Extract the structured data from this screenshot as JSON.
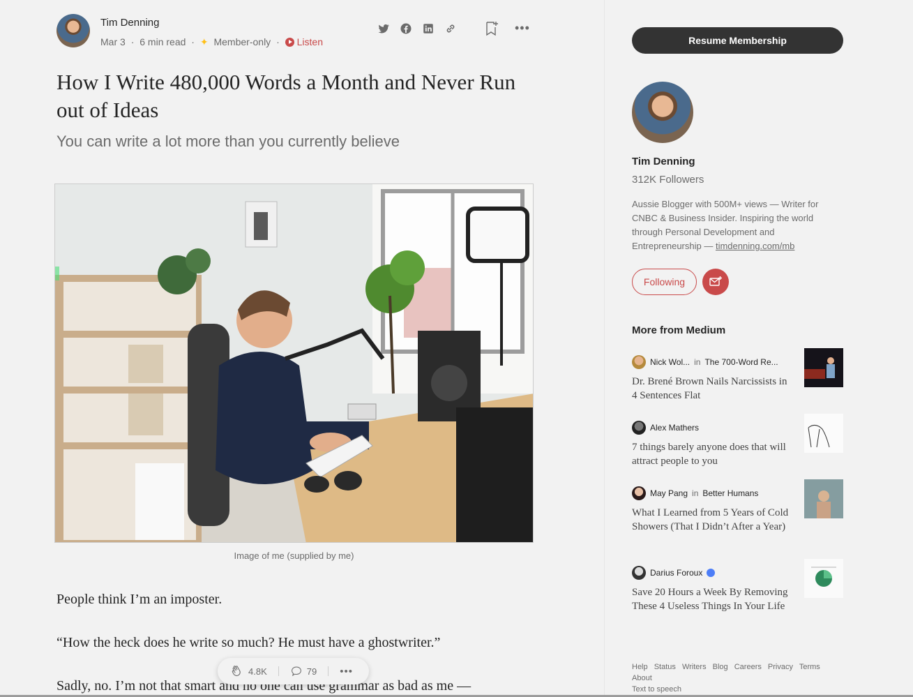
{
  "article": {
    "author_name": "Tim Denning",
    "date": "Mar 3",
    "read_time": "6 min read",
    "member_label": "Member-only",
    "listen_label": "Listen",
    "title": "How I Write 480,000 Words a Month and Never Run out of Ideas",
    "subtitle": "You can write a lot more than you currently believe",
    "caption": "Image of me (supplied by me)",
    "paragraphs": [
      "People think I’m an imposter.",
      "“How the heck does he write so much? He must have a ghostwriter.”",
      "Sadly, no. I’m not that smart and no one can use grammar as bad as me —"
    ],
    "share_icons": [
      "twitter-icon",
      "facebook-icon",
      "linkedin-icon",
      "link-icon"
    ]
  },
  "floatbar": {
    "claps": "4.8K",
    "responses": "79"
  },
  "sidebar": {
    "resume_label": "Resume Membership",
    "author_name": "Tim Denning",
    "followers": "312K Followers",
    "bio_text": "Aussie Blogger with 500M+ views — Writer for CNBC & Business Insider. Inspiring the world through Personal Development and Entrepreneurship — ",
    "bio_link": "timdenning.com/mb",
    "following_label": "Following",
    "more_from_label": "More from Medium",
    "stories": [
      {
        "author": "Nick Wol...",
        "in": "in",
        "publication": "The 700-Word Re...",
        "title": "Dr. Brené Brown Nails Narcissists in 4 Sentences Flat"
      },
      {
        "author": "Alex Mathers",
        "in": "",
        "publication": "",
        "title": "7 things barely anyone does that will attract people to you"
      },
      {
        "author": "May Pang",
        "in": "in",
        "publication": "Better Humans",
        "title": "What I Learned from 5 Years of Cold Showers (That I Didn’t After a Year)"
      },
      {
        "author": "Darius Foroux",
        "in": "",
        "publication": "",
        "title": "Save 20 Hours a Week By Removing These 4 Useless Things In Your Life"
      }
    ],
    "footer_links": [
      "Help",
      "Status",
      "Writers",
      "Blog",
      "Careers",
      "Privacy",
      "Terms",
      "About",
      "Text to speech"
    ]
  },
  "colors": {
    "accent_red": "#c94a4a",
    "dark_button": "#333333",
    "background": "#f2f2f2"
  }
}
